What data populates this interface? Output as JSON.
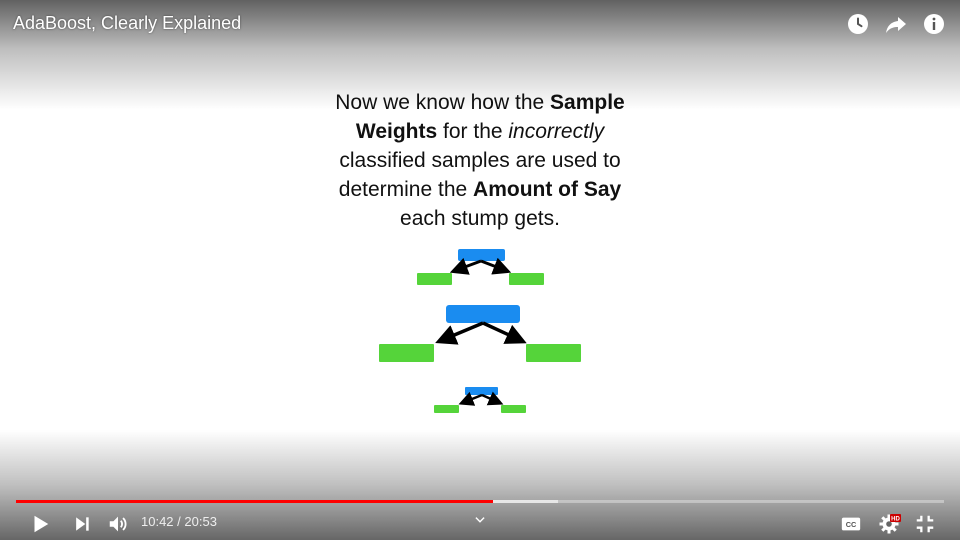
{
  "player": {
    "title": "AdaBoost, Clearly Explained",
    "time_current": "10:42",
    "time_separator": " / ",
    "time_total": "20:53",
    "progress_played": 0.514,
    "progress_buffered": 0.584,
    "accent_color": "#ff0000",
    "hd_badge": "HD"
  },
  "icons": {
    "top": [
      "watch-later-icon",
      "share-icon",
      "info-icon"
    ],
    "controls": [
      "play-icon",
      "next-icon",
      "volume-icon",
      "chevron-down-icon",
      "captions-icon",
      "settings-icon",
      "exit-fullscreen-icon"
    ]
  },
  "slide": {
    "line1_a": "Now we know how the ",
    "line1_b": "Sample",
    "line2_a": "Weights",
    "line2_b": " for the ",
    "line2_c": "incorrectly",
    "line3": "classified samples are used to",
    "line4_a": "determine the ",
    "line4_b": "Amount of Say",
    "line5": "each stump gets.",
    "colors": {
      "root": "#1a8cf0",
      "leaf": "#55d43a",
      "arrow": "#000000"
    }
  }
}
